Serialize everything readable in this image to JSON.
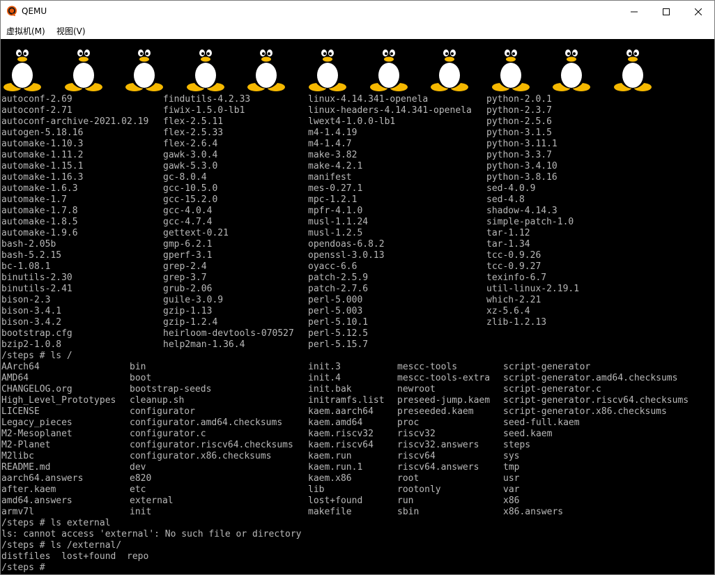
{
  "window": {
    "title": "QEMU",
    "minimize_icon": "minimize-icon",
    "maximize_icon": "maximize-icon",
    "close_icon": "close-icon"
  },
  "menu": [
    {
      "label": "虚拟机(M)"
    },
    {
      "label": "视图(V)"
    }
  ],
  "screen": {
    "logo_icon": "tux-penguin-icon",
    "logo_count": 11,
    "text_color": "#b8b8b8",
    "background": "#000000",
    "lines": [
      [
        "autoconf-2.69",
        "findutils-4.2.33",
        "linux-4.14.341-openela",
        "python-2.0.1"
      ],
      [
        "autoconf-2.71",
        "fiwix-1.5.0-lb1",
        "linux-headers-4.14.341-openela",
        "python-2.3.7"
      ],
      [
        "autoconf-archive-2021.02.19",
        "flex-2.5.11",
        "lwext4-1.0.0-lb1",
        "python-2.5.6"
      ],
      [
        "autogen-5.18.16",
        "flex-2.5.33",
        "m4-1.4.19",
        "python-3.1.5"
      ],
      [
        "automake-1.10.3",
        "flex-2.6.4",
        "m4-1.4.7",
        "python-3.11.1"
      ],
      [
        "automake-1.11.2",
        "gawk-3.0.4",
        "make-3.82",
        "python-3.3.7"
      ],
      [
        "automake-1.15.1",
        "gawk-5.3.0",
        "make-4.2.1",
        "python-3.4.10"
      ],
      [
        "automake-1.16.3",
        "gc-8.0.4",
        "manifest",
        "python-3.8.16"
      ],
      [
        "automake-1.6.3",
        "gcc-10.5.0",
        "mes-0.27.1",
        "sed-4.0.9"
      ],
      [
        "automake-1.7",
        "gcc-15.2.0",
        "mpc-1.2.1",
        "sed-4.8"
      ],
      [
        "automake-1.7.8",
        "gcc-4.0.4",
        "mpfr-4.1.0",
        "shadow-4.14.3"
      ],
      [
        "automake-1.8.5",
        "gcc-4.7.4",
        "musl-1.1.24",
        "simple-patch-1.0"
      ],
      [
        "automake-1.9.6",
        "gettext-0.21",
        "musl-1.2.5",
        "tar-1.12"
      ],
      [
        "bash-2.05b",
        "gmp-6.2.1",
        "opendoas-6.8.2",
        "tar-1.34"
      ],
      [
        "bash-5.2.15",
        "gperf-3.1",
        "openssl-3.0.13",
        "tcc-0.9.26"
      ],
      [
        "bc-1.08.1",
        "grep-2.4",
        "oyacc-6.6",
        "tcc-0.9.27"
      ],
      [
        "binutils-2.30",
        "grep-3.7",
        "patch-2.5.9",
        "texinfo-6.7"
      ],
      [
        "binutils-2.41",
        "grub-2.06",
        "patch-2.7.6",
        "util-linux-2.19.1"
      ],
      [
        "bison-2.3",
        "guile-3.0.9",
        "perl-5.000",
        "which-2.21"
      ],
      [
        "bison-3.4.1",
        "gzip-1.13",
        "perl-5.003",
        "xz-5.6.4"
      ],
      [
        "bison-3.4.2",
        "gzip-1.2.4",
        "perl-5.10.1",
        "zlib-1.2.13"
      ],
      [
        "bootstrap.cfg",
        "heirloom-devtools-070527",
        "perl-5.12.5",
        ""
      ],
      [
        "bzip2-1.0.8",
        "help2man-1.36.4",
        "perl-5.15.7",
        ""
      ],
      [
        "/steps # ls /"
      ],
      [
        "AArch64",
        "bin",
        "init.3",
        "mescc-tools",
        "script-generator"
      ],
      [
        "AMD64",
        "boot",
        "init.4",
        "mescc-tools-extra",
        "script-generator.amd64.checksums"
      ],
      [
        "CHANGELOG.org",
        "bootstrap-seeds",
        "init.bak",
        "newroot",
        "script-generator.c"
      ],
      [
        "High_Level_Prototypes",
        "cleanup.sh",
        "initramfs.list",
        "preseed-jump.kaem",
        "script-generator.riscv64.checksums"
      ],
      [
        "LICENSE",
        "configurator",
        "kaem.aarch64",
        "preseeded.kaem",
        "script-generator.x86.checksums"
      ],
      [
        "Legacy_pieces",
        "configurator.amd64.checksums",
        "kaem.amd64",
        "proc",
        "seed-full.kaem"
      ],
      [
        "M2-Mesoplanet",
        "configurator.c",
        "kaem.riscv32",
        "riscv32",
        "seed.kaem"
      ],
      [
        "M2-Planet",
        "configurator.riscv64.checksums",
        "kaem.riscv64",
        "riscv32.answers",
        "steps"
      ],
      [
        "M2libc",
        "configurator.x86.checksums",
        "kaem.run",
        "riscv64",
        "sys"
      ],
      [
        "README.md",
        "dev",
        "kaem.run.1",
        "riscv64.answers",
        "tmp"
      ],
      [
        "aarch64.answers",
        "e820",
        "kaem.x86",
        "root",
        "usr"
      ],
      [
        "after.kaem",
        "etc",
        "lib",
        "rootonly",
        "var"
      ],
      [
        "amd64.answers",
        "external",
        "lost+found",
        "run",
        "x86"
      ],
      [
        "armv7l",
        "init",
        "makefile",
        "sbin",
        "x86.answers"
      ],
      [
        "/steps # ls external"
      ],
      [
        "ls: cannot access 'external': No such file or directory"
      ],
      [
        "/steps # ls /external/"
      ],
      [
        "distfiles  lost+found  repo"
      ],
      [
        "/steps # "
      ]
    ]
  }
}
